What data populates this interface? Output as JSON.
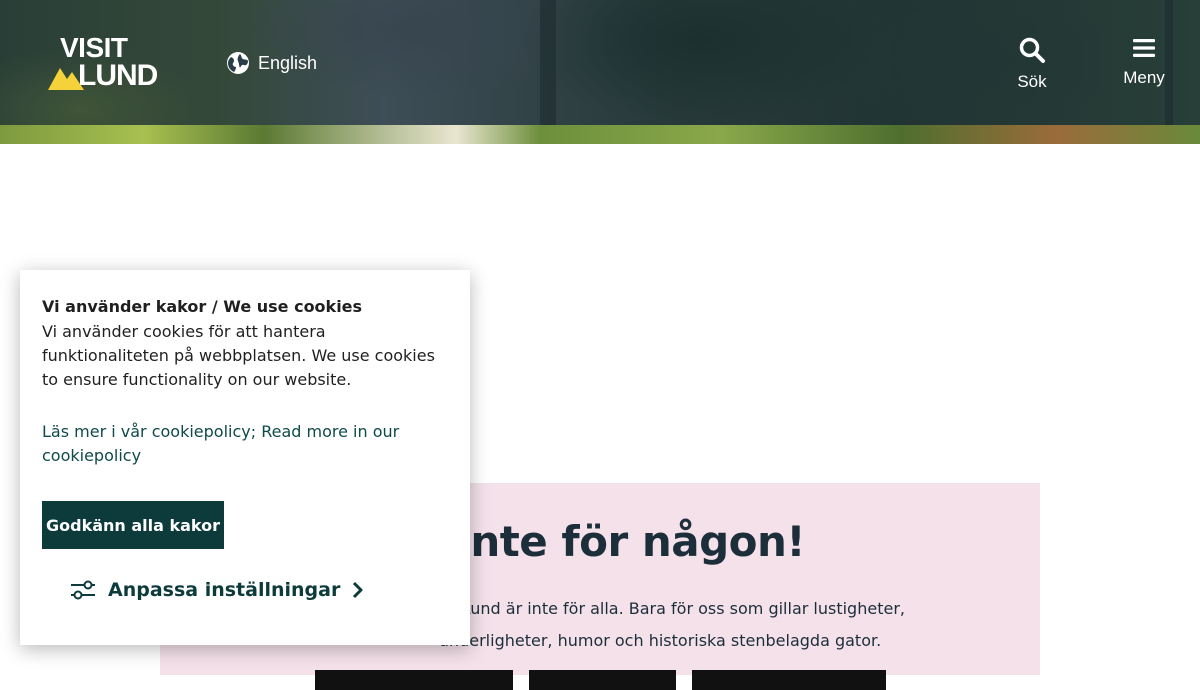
{
  "header": {
    "logo_top": "VISIT",
    "logo_bottom": "LUND",
    "language_label": "English",
    "search_label": "Sök",
    "menu_label": "Meny"
  },
  "icons": {
    "globe": "globe-icon",
    "search": "search-icon",
    "menu": "hamburger-menu-icon",
    "sliders": "sliders-icon",
    "chevron": "chevron-right-icon"
  },
  "promo": {
    "heading": "ta inte för någon!",
    "text": "ghet. Lund är inte för alla. Bara för oss som gillar lustigheter, underligheter, humor och historiska stenbelagda gator."
  },
  "cookie": {
    "title": "Vi använder kakor / We use cookies",
    "body": "Vi använder cookies för att hantera funktionaliteten på webbplatsen. We use cookies to ensure functionality on our website.",
    "policy_link": "Läs mer i vår cookiepolicy; Read more in our cookiepolicy",
    "accept_button": "Godkänn alla kakor",
    "customize_button": "Anpassa inställningar"
  },
  "colors": {
    "accent_dark_teal": "#0d3b3b",
    "logo_yellow": "#f5d23a",
    "promo_pink": "#f4e1ea",
    "heading_navy": "#1c2e3a"
  }
}
